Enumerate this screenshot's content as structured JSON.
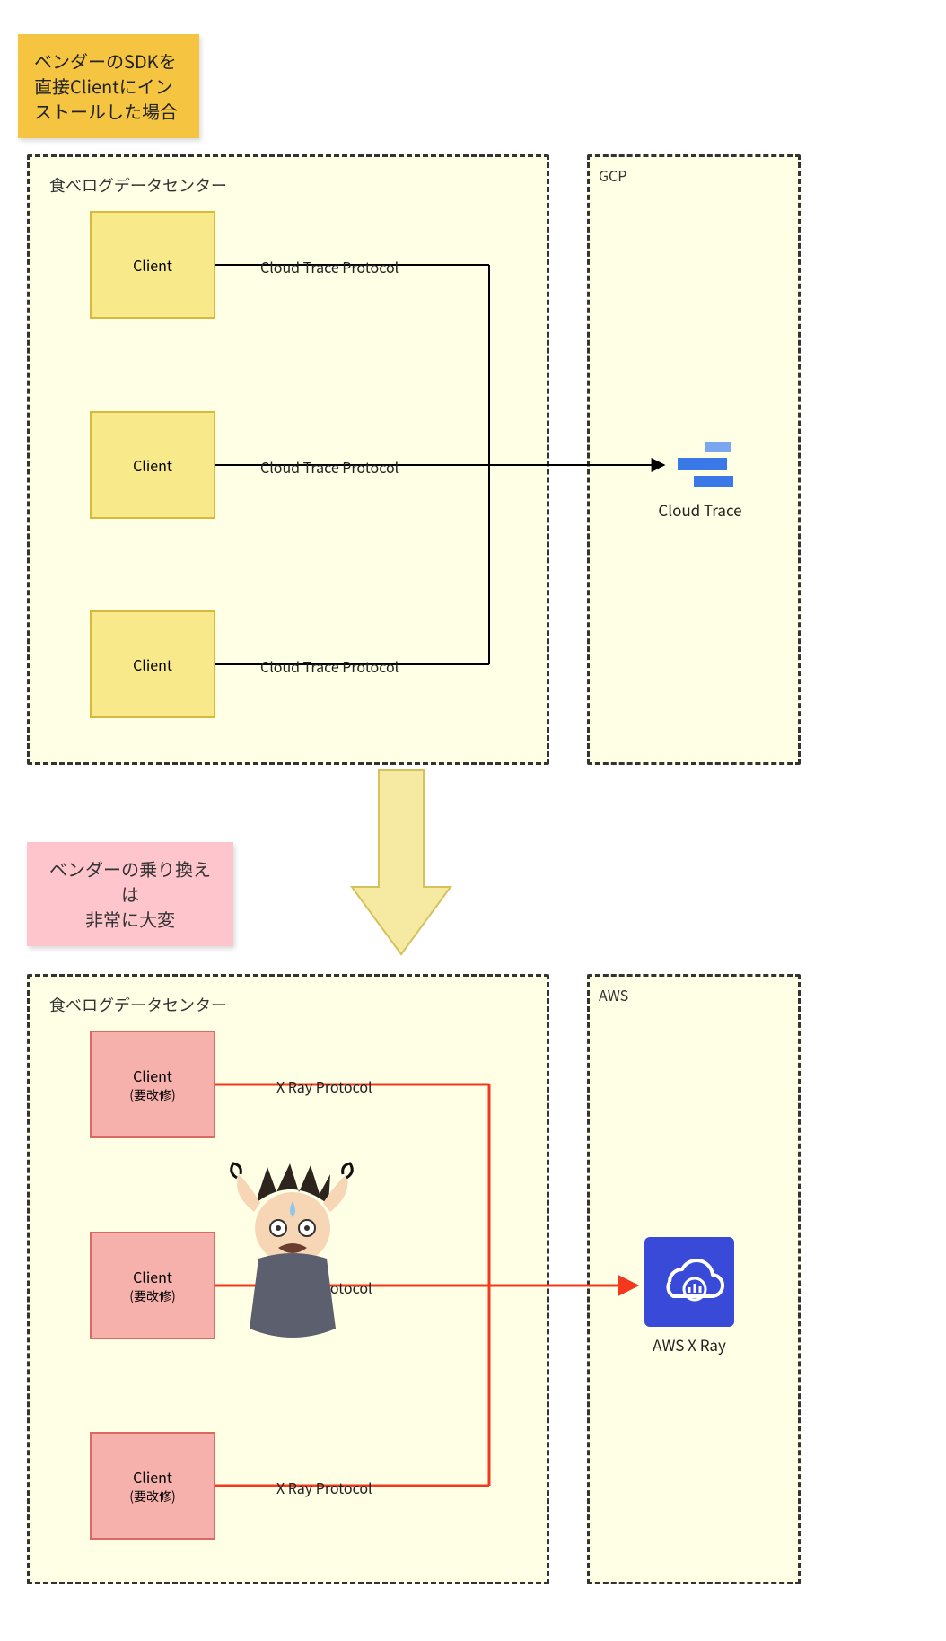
{
  "notes": {
    "top": "ベンダーのSDKを\n直接Clientにイン\nストールした場合",
    "middle": "ベンダーの乗り換えは\n非常に大変"
  },
  "top_diagram": {
    "dc_title": "食べログデータセンター",
    "client_label": "Client",
    "protocol": "Cloud Trace Protocol",
    "cloud_container": "GCP",
    "service": "Cloud Trace"
  },
  "bottom_diagram": {
    "dc_title": "食べログデータセンター",
    "client_label": "Client",
    "client_sub": "(要改修)",
    "protocol": "X Ray Protocol",
    "cloud_container": "AWS",
    "service": "AWS X Ray"
  }
}
